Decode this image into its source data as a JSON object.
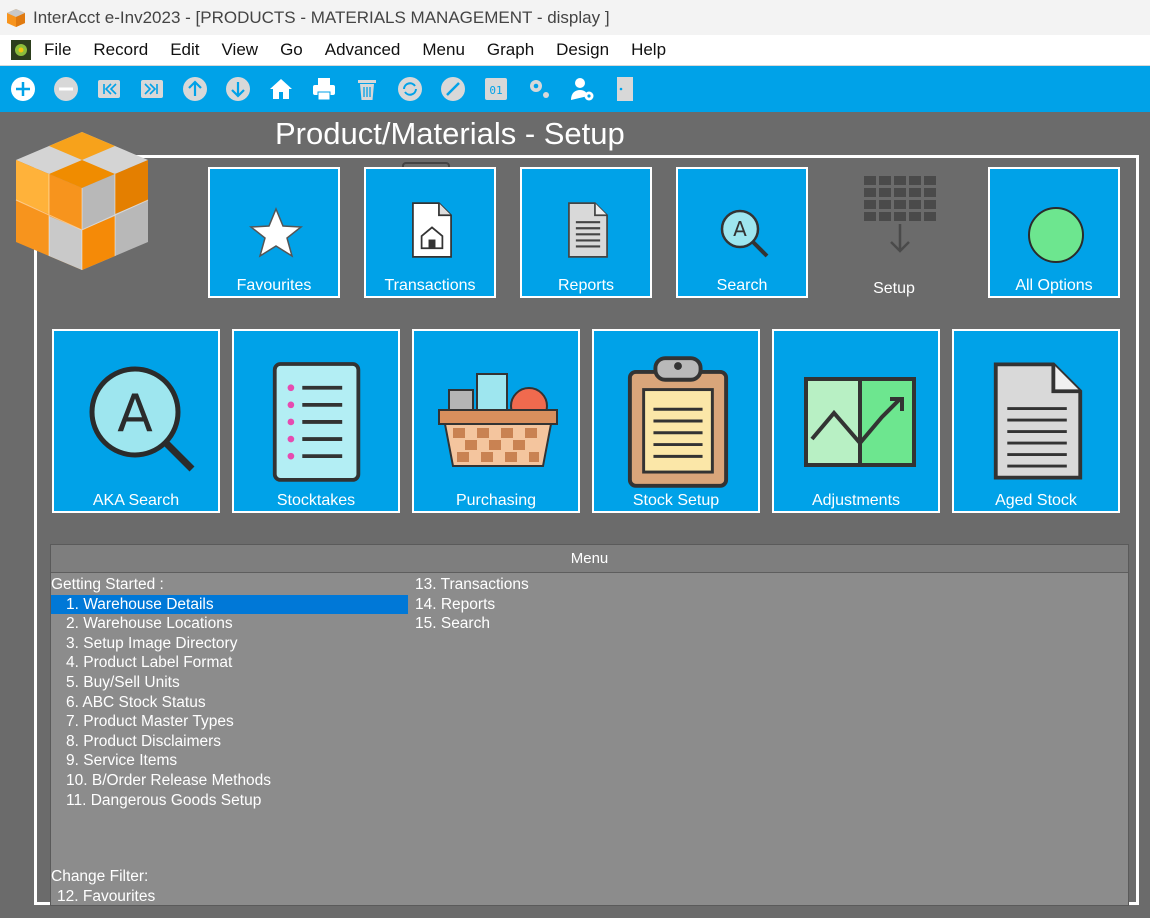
{
  "window": {
    "title": "InterAcct e-Inv2023 - [PRODUCTS - MATERIALS MANAGEMENT - display ]"
  },
  "menubar": {
    "items": [
      "File",
      "Record",
      "Edit",
      "View",
      "Go",
      "Advanced",
      "Menu",
      "Graph",
      "Design",
      "Help"
    ]
  },
  "toolbar": {
    "icons": [
      "add-icon",
      "remove-icon",
      "first-record-icon",
      "last-record-icon",
      "previous-icon",
      "next-icon",
      "home-icon",
      "print-icon",
      "delete-icon",
      "refresh-icon",
      "cancel-icon",
      "record-number-icon",
      "settings-icon",
      "user-settings-icon",
      "exit-door-icon"
    ]
  },
  "page": {
    "title": "Product/Materials - Setup"
  },
  "top_tiles": [
    {
      "label": "Favourites",
      "icon": "star-icon"
    },
    {
      "label": "Transactions",
      "icon": "document-house-icon"
    },
    {
      "label": "Reports",
      "icon": "report-document-icon"
    },
    {
      "label": "Search",
      "icon": "search-a-icon"
    },
    {
      "label": "Setup",
      "icon": "grid-arrow-icon"
    },
    {
      "label": "All Options",
      "icon": "green-circle-icon"
    }
  ],
  "big_tiles": [
    {
      "label": "AKA Search",
      "icon": "magnifier-a-icon"
    },
    {
      "label": "Stocktakes",
      "icon": "checklist-icon"
    },
    {
      "label": "Purchasing",
      "icon": "basket-icon"
    },
    {
      "label": "Stock Setup",
      "icon": "clipboard-icon"
    },
    {
      "label": "Adjustments",
      "icon": "chart-trend-icon"
    },
    {
      "label": "Aged Stock",
      "icon": "aged-document-icon"
    }
  ],
  "menu": {
    "header": "Menu",
    "section_getting_started": "Getting Started :",
    "items_col1": [
      "1. Warehouse Details",
      "2. Warehouse Locations",
      "3. Setup Image Directory",
      "4. Product Label Format",
      "5. Buy/Sell Units",
      "6. ABC Stock Status",
      "7. Product Master Types",
      "8. Product Disclaimers",
      "9. Service Items",
      "10. B/Order Release Methods",
      "11. Dangerous Goods Setup"
    ],
    "items_col2": [
      "13. Transactions",
      "14. Reports",
      "15. Search"
    ],
    "selected_item": "1. Warehouse Details",
    "section_change_filter": "Change Filter:",
    "filter_items": [
      "12. Favourites"
    ]
  },
  "colors": {
    "accent": "#00a2e8",
    "background": "#6b6b6b",
    "menu_panel": "#8c8c8c",
    "selection": "#0078d7"
  }
}
